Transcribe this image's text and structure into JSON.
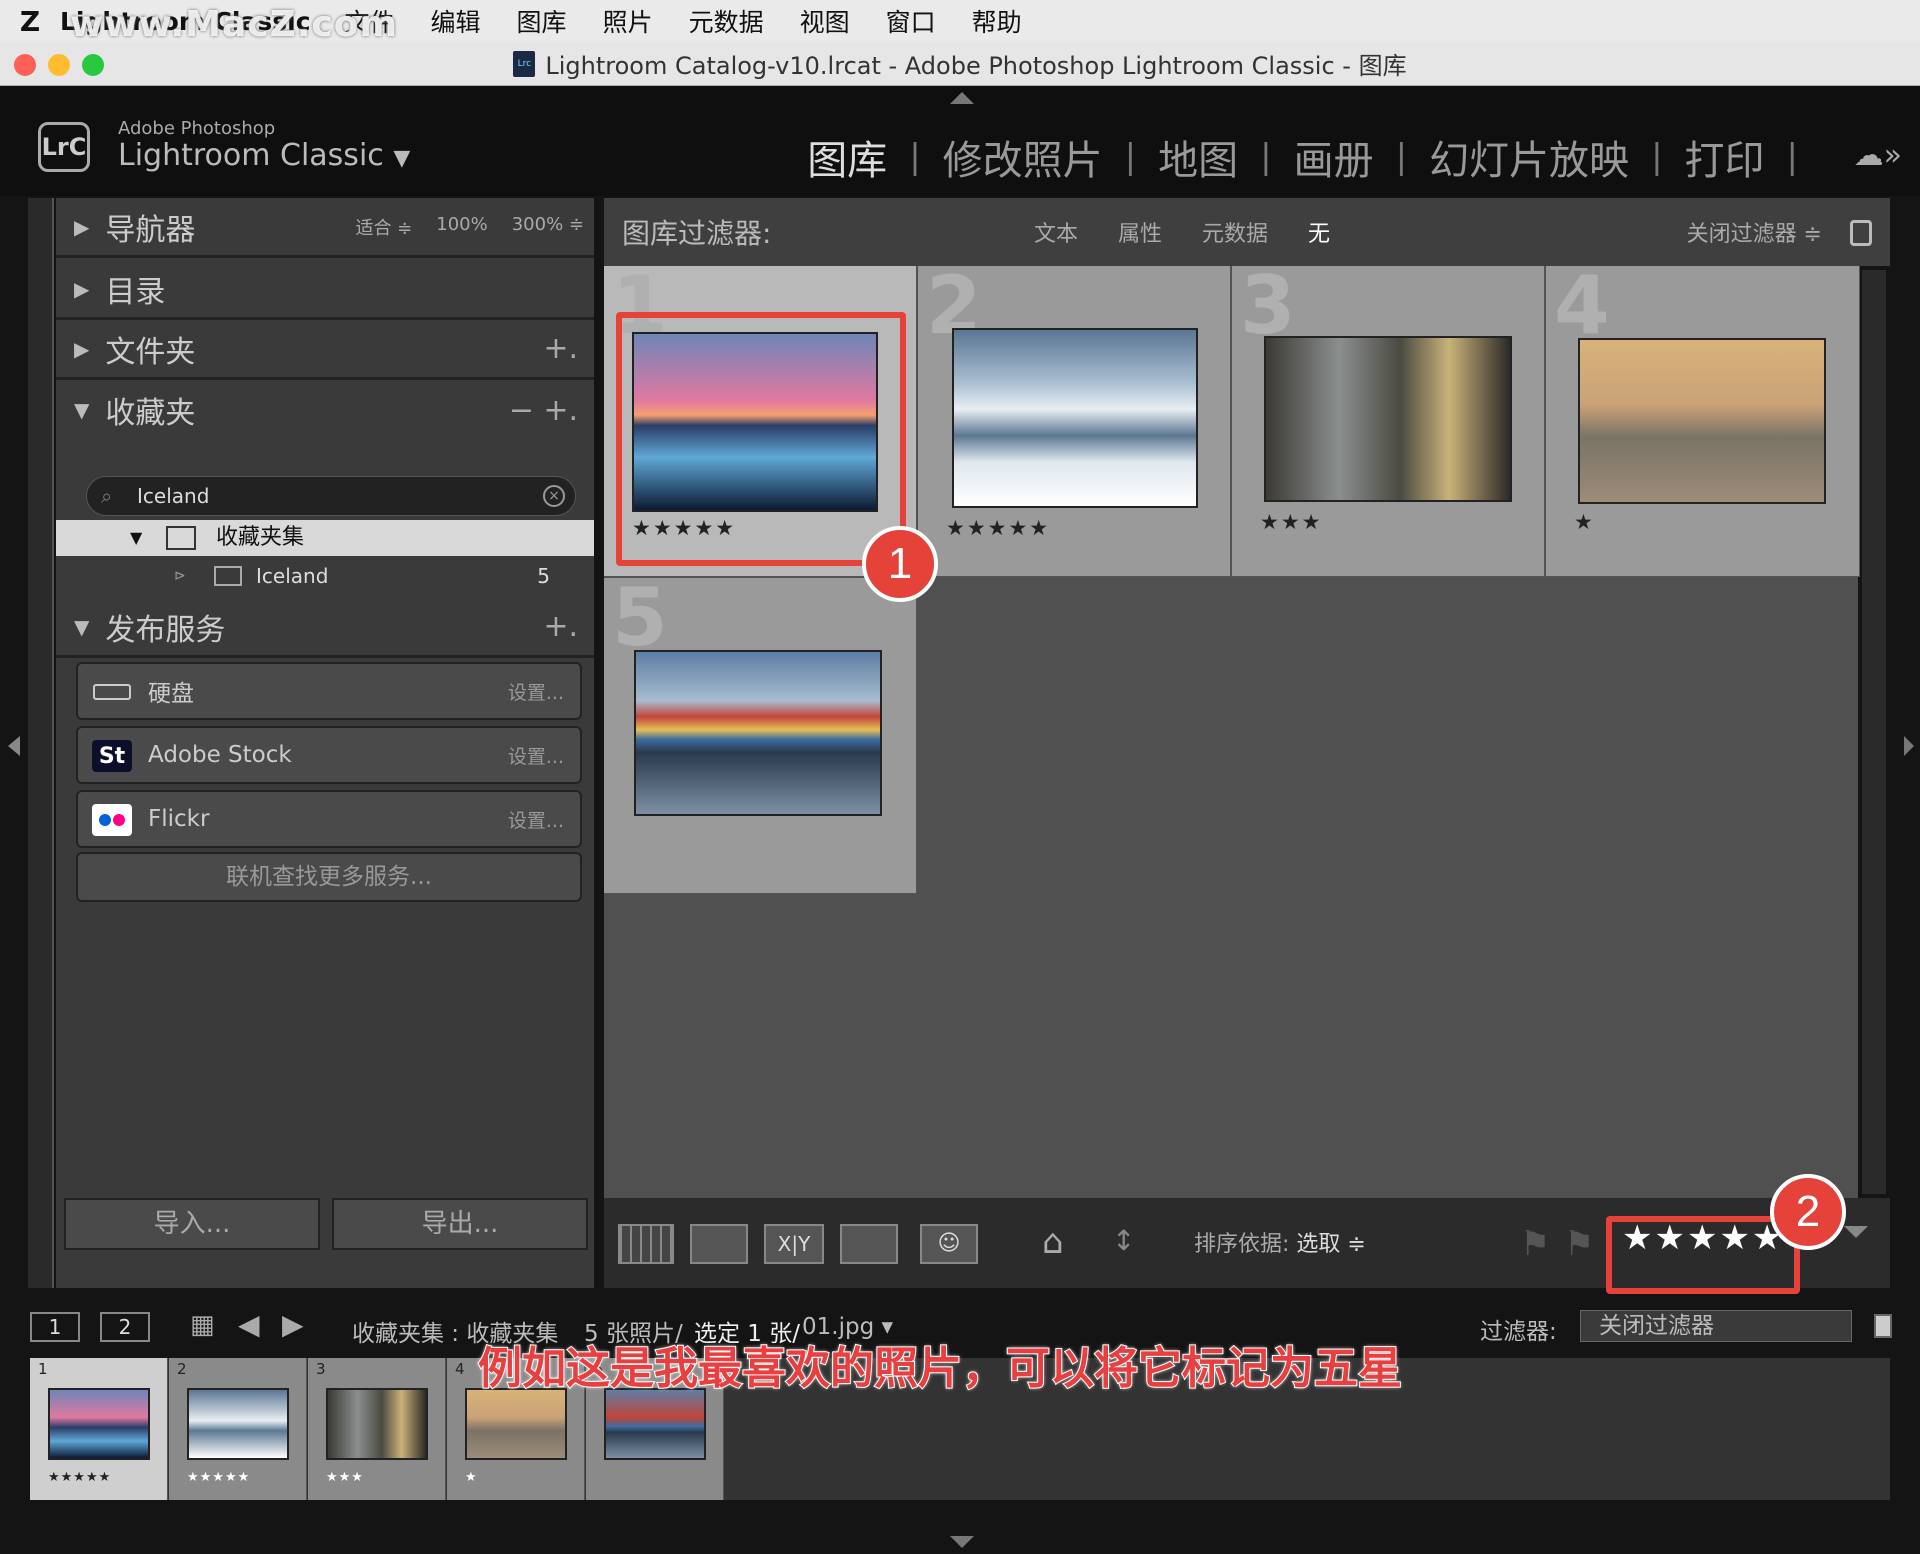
{
  "menubar": {
    "app": "Lightroom Classic",
    "items": [
      "文件",
      "编辑",
      "图库",
      "照片",
      "元数据",
      "视图",
      "窗口",
      "帮助"
    ],
    "watermark": "www.MacZ.com"
  },
  "window": {
    "title": "Lightroom Catalog-v10.lrcat - Adobe Photoshop Lightroom Classic - 图库",
    "catalog_icon": "Lrc"
  },
  "identity": {
    "logo": "LrC",
    "sub": "Adobe Photoshop",
    "main": "Lightroom Classic",
    "arrow": "▼"
  },
  "modules": [
    {
      "label": "图库",
      "active": true
    },
    {
      "label": "修改照片"
    },
    {
      "label": "地图"
    },
    {
      "label": "画册"
    },
    {
      "label": "幻灯片放映"
    },
    {
      "label": "打印"
    }
  ],
  "left": {
    "navigator": {
      "title": "导航器",
      "opts": [
        "适合 ≑",
        "100%",
        "300% ≑"
      ]
    },
    "catalog": {
      "title": "目录"
    },
    "folders": {
      "title": "文件夹",
      "action": "+."
    },
    "collections": {
      "title": "收藏夹",
      "minus": "−",
      "plus": "+.",
      "search": "Iceland",
      "set": "收藏夹集",
      "col": "Iceland",
      "count": "5"
    },
    "publish": {
      "title": "发布服务",
      "plus": "+.",
      "services": [
        {
          "name": "硬盘",
          "set": "设置..."
        },
        {
          "name": "Adobe Stock",
          "set": "设置...",
          "icon": "St"
        },
        {
          "name": "Flickr",
          "set": "设置..."
        }
      ],
      "more": "联机查找更多服务..."
    },
    "import": "导入...",
    "export": "导出..."
  },
  "filter": {
    "title": "图库过滤器:",
    "options": [
      "文本",
      "属性",
      "元数据",
      "无"
    ],
    "close": "关闭过滤器 ≑"
  },
  "grid": [
    {
      "num": "1",
      "stars": "★★★★★",
      "selected": true
    },
    {
      "num": "2",
      "stars": "★★★★★"
    },
    {
      "num": "3",
      "stars": "★★★"
    },
    {
      "num": "4",
      "stars": "★"
    },
    {
      "num": "5",
      "stars": ""
    }
  ],
  "toolbar": {
    "sort_label": "排序依据:",
    "sort_value": "选取 ≑",
    "rating": "★★★★★"
  },
  "filmstrip": {
    "page1": "1",
    "page2": "2",
    "path": "收藏夹集 : 收藏夹集",
    "count": "5 张照片/",
    "selected": "选定 1 张/",
    "file": "01.jpg ▾",
    "filter_label": "过滤器:",
    "filter_value": "关闭过滤器",
    "thumbs": [
      {
        "n": "1",
        "st": "★★★★★"
      },
      {
        "n": "2",
        "st": "★★★★★"
      },
      {
        "n": "3",
        "st": "★★★"
      },
      {
        "n": "4",
        "st": "★"
      },
      {
        "n": "5",
        "st": ""
      }
    ]
  },
  "caption": "例如这是我最喜欢的照片，可以将它标记为五星",
  "badges": [
    "1",
    "2"
  ],
  "colors": {
    "accent": "#e5433a",
    "panel": "#3a3a3a",
    "grid": "#505050"
  }
}
